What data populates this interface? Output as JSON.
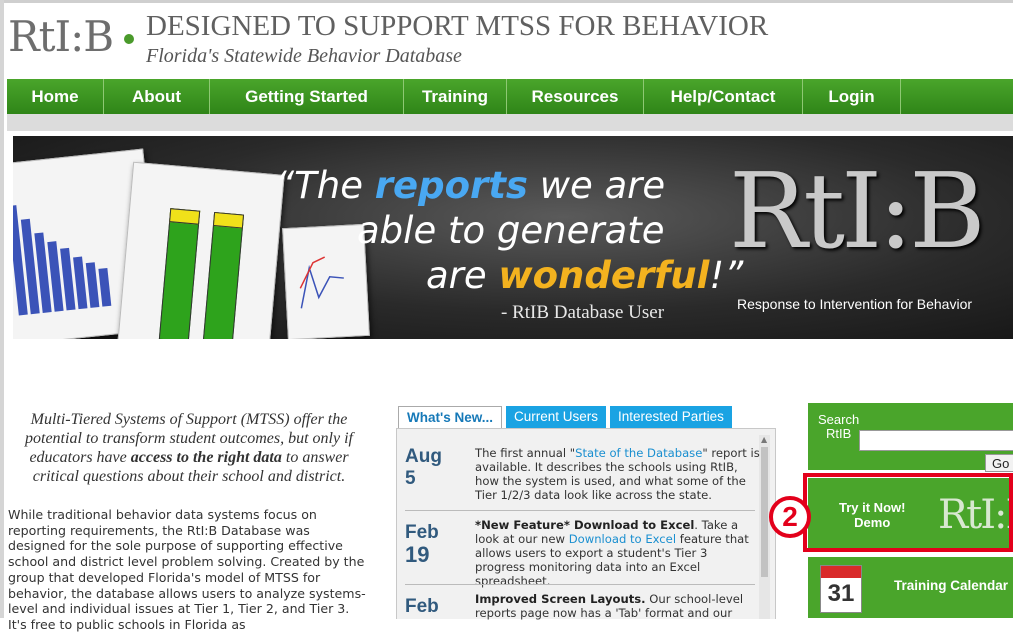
{
  "header": {
    "logo": "RtI:B",
    "tagline": "DESIGNED TO SUPPORT MTSS FOR BEHAVIOR",
    "subtitle": "Florida's Statewide Behavior Database"
  },
  "nav": {
    "items": [
      {
        "label": "Home"
      },
      {
        "label": "About"
      },
      {
        "label": "Getting Started"
      },
      {
        "label": "Training"
      },
      {
        "label": "Resources"
      },
      {
        "label": "Help/Contact"
      },
      {
        "label": "Login"
      }
    ]
  },
  "banner": {
    "quote_open": "“The ",
    "quote_hl1": "reports",
    "quote_mid": " we are",
    "quote_line2": "able to generate",
    "quote_line3a": "are ",
    "quote_hl2": "wonderful",
    "quote_line3b": "!”",
    "attribution": "- RtIB Database User",
    "logo": "RtI:B",
    "logo_sub": "Response to Intervention for Behavior"
  },
  "intro": {
    "part1": "Multi-Tiered Systems of Support (MTSS) offer the potential to transform student outcomes, but only if educators have ",
    "bold": "access to the right data",
    "part2": " to answer critical questions about their school and district."
  },
  "body_text": "While traditional behavior data systems focus on reporting requirements, the RtI:B Database was designed for the sole purpose of supporting effective school and district level problem solving. Created by the group that developed Florida's model of MTSS for behavior, the database allows users to analyze systems-level and individual issues at Tier 1, Tier 2, and Tier 3. It's free to public schools in Florida as",
  "tabs": [
    {
      "label": "What's New..."
    },
    {
      "label": "Current Users"
    },
    {
      "label": "Interested Parties"
    }
  ],
  "news": [
    {
      "month": "Aug",
      "day": "5",
      "pre": "The first annual \"",
      "link": "State of the Database",
      "post": "\" report is available. It describes the schools using RtIB, how the system is used, and what some of the Tier 1/2/3 data look like across the state."
    },
    {
      "month": "Feb",
      "day": "19",
      "bold": "*New Feature* Download to Excel",
      "pre": ". Take a look at our new ",
      "link": "Download to Excel",
      "post": " feature that allows users to export a student's Tier 3 progress monitoring data into an Excel spreadsheet."
    },
    {
      "month": "Feb",
      "bold": "Improved Screen Layouts.",
      "post": " Our school-level reports page now has a 'Tab' format and our"
    }
  ],
  "search": {
    "label_line1": "Search",
    "label_line2": "RtIB",
    "value": "",
    "button": "Go"
  },
  "demo": {
    "line1": "Try it Now!",
    "line2": "Demo",
    "logo": "RtI:B",
    "badge": "2"
  },
  "calendar": {
    "icon_day": "31",
    "label": "Training Calendar"
  },
  "colors": {
    "nav_green": "#3a9620",
    "accent_blue": "#1aa3e3",
    "highlight_red": "#e3001b"
  }
}
